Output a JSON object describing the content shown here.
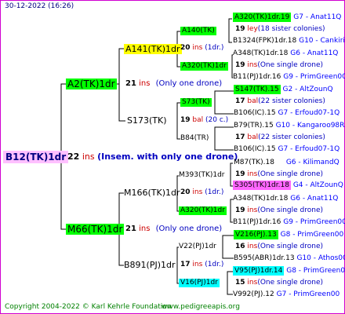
{
  "header": "30-12-2022 (16:26)",
  "footer": {
    "copyright": "Copyright 2004-2022 © Karl Kehrle Foundation",
    "url": "www.pedigreeapis.org"
  },
  "colors": {
    "frame": "#d000d0",
    "green": "#00ff00",
    "yellow": "#ffff00",
    "magenta": "#ff66ff",
    "cyan": "#00ffff",
    "root": "#ffc0ff"
  },
  "root": {
    "id": "B12(TK)1dr",
    "year": "22",
    "unit": "ins",
    "note": "(Insem. with only one drone)"
  },
  "gen2": [
    {
      "id": "A2(TK)1dr",
      "year": "21",
      "unit": "ins",
      "note": "(Only one drone)"
    },
    {
      "id": "M66(TK)1dr",
      "year": "21",
      "unit": "ins",
      "note": "(Only one drone)"
    }
  ],
  "gen3": [
    {
      "id": "A141(TK)1dr",
      "year": "20",
      "unit": "ins",
      "note": "(1dr.)"
    },
    {
      "id": "S173(TK)",
      "year": "19",
      "unit": "bal",
      "note": "(20 c.)"
    },
    {
      "id": "M166(TK)1dr",
      "year": "20",
      "unit": "ins",
      "note": "(1dr.)"
    },
    {
      "id": "B891(PJ)1dr",
      "year": "17",
      "unit": "ins",
      "note": "(1dr.)"
    }
  ],
  "gen4": [
    {
      "id": "A140(TK)"
    },
    {
      "id": "A320(TK)1dr"
    },
    {
      "id": "S73(TK)"
    },
    {
      "id": "B84(TR)"
    },
    {
      "id": "M393(TK)1dr"
    },
    {
      "id": "A320(TK)1dr"
    },
    {
      "id": "V22(PJ)1dr"
    },
    {
      "id": "V16(PJ)1dr"
    }
  ],
  "gen5": [
    {
      "id": "A320(TK)1dr.19",
      "info": "G7 - Anat11Q"
    },
    {
      "year": "19",
      "unit": "ley",
      "note": "(18 sister colonies)"
    },
    {
      "id": "B1324(FPK)1dr.18",
      "info": "G10 - Cankiri97Q"
    },
    {
      "id": "A348(TK)1dr.18",
      "info": "G6 - Anat11Q"
    },
    {
      "year": "19",
      "unit": "ins",
      "note": "(One single drone)"
    },
    {
      "id": "B11(PJ)1dr.16",
      "info": "G9 - PrimGreen00"
    },
    {
      "id": "S147(TK).15",
      "info": "G2 - AltZounQ"
    },
    {
      "year": "17",
      "unit": "bal",
      "note": "(22 sister colonies)"
    },
    {
      "id": "B106(IC).15",
      "info": "G7 - Erfoud07-1Q"
    },
    {
      "id": "B79(TR).15",
      "info": "G10 - Kangaroo98R"
    },
    {
      "year": "17",
      "unit": "bal",
      "note": "(22 sister colonies)"
    },
    {
      "id": "B106(IC).15",
      "info": "G7 - Erfoud07-1Q"
    },
    {
      "id": "M87(TK).18",
      "info": "G6 - KilimandQ"
    },
    {
      "year": "19",
      "unit": "ins",
      "note": "(One single drone)"
    },
    {
      "id": "S305(TK)1dr.18",
      "info": "G4 - AltZounQ"
    },
    {
      "id": "A348(TK)1dr.18",
      "info": "G6 - Anat11Q"
    },
    {
      "year": "19",
      "unit": "ins",
      "note": "(One single drone)"
    },
    {
      "id": "B11(PJ)1dr.16",
      "info": "G9 - PrimGreen00"
    },
    {
      "id": "V216(PJ).13",
      "info": "G8 - PrimGreen00"
    },
    {
      "year": "16",
      "unit": "ins",
      "note": "(One single drone)"
    },
    {
      "id": "B595(ABR)1dr.13",
      "info": "G10 - Athos00R"
    },
    {
      "id": "V95(PJ)1dr.14",
      "info": "G8 - PrimGreen00"
    },
    {
      "year": "15",
      "unit": "ins",
      "note": "(One single drone)"
    },
    {
      "id": "V992(PJ).12",
      "info": "G7 - PrimGreen00"
    }
  ]
}
